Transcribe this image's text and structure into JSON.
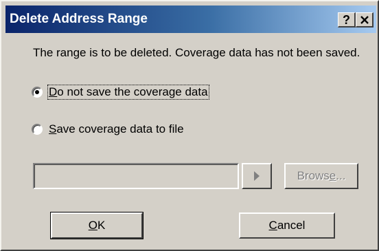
{
  "window": {
    "title": "Delete Address Range",
    "help_icon": "question-mark",
    "close_icon": "x-close"
  },
  "message": "The range is to be deleted. Coverage data has not been saved.",
  "options": {
    "do_not_save": {
      "label": "Do not save the coverage data",
      "mnemonic": "D",
      "rest": "o not save the coverage data",
      "selected": true
    },
    "save_to_file": {
      "label": "Save coverage data to file",
      "mnemonic": "S",
      "rest": "ave coverage data to file",
      "selected": false
    }
  },
  "file_path": {
    "value": "",
    "enabled": false
  },
  "arrow_button": {
    "icon": "triangle-right"
  },
  "browse_button": {
    "label": "Browse...",
    "before": "Brows",
    "mnemonic": "e",
    "after": "...",
    "enabled": false
  },
  "ok_button": {
    "label": "OK",
    "mnemonic": "O",
    "rest": "K"
  },
  "cancel_button": {
    "label": "Cancel",
    "mnemonic": "C",
    "rest": "ancel"
  }
}
